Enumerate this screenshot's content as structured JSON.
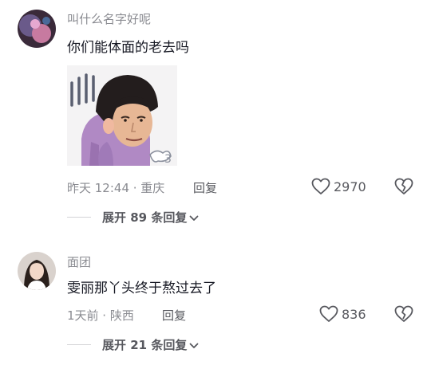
{
  "comments": [
    {
      "username": "叫什么名字好呢",
      "content": "你们能体面的老去吗",
      "meta": "昨天 12:44 · 重庆",
      "reply_label": "回复",
      "like_count": "2970",
      "expand_label": "展开 89 条回复",
      "has_sticker": true
    },
    {
      "username": "面团",
      "content": "雯丽那丫头终于熬过去了",
      "meta": "1天前 · 陕西",
      "reply_label": "回复",
      "like_count": "836",
      "expand_label": "展开 21 条回复"
    }
  ],
  "icons": {
    "like": "heart-outline-icon",
    "dislike": "broken-heart-icon",
    "expand": "chevron-down-icon"
  },
  "colors": {
    "text_primary": "#161823",
    "text_secondary": "#8a8b91",
    "text_action": "#57585e"
  }
}
